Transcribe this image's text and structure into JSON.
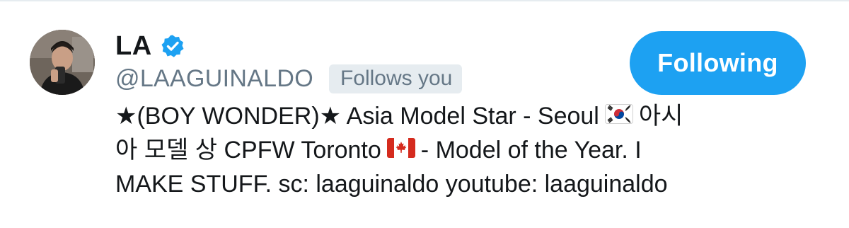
{
  "profile": {
    "display_name": "LA",
    "verified": true,
    "handle": "@LAAGUINALDO",
    "follows_you_label": "Follows you",
    "follow_button_label": "Following",
    "bio": {
      "line1_a": "★(BOY WONDER)★ Asia Model Star - Seoul",
      "line1_flag": "south-korea-flag-icon",
      "line1_b": "아시",
      "line2_a": "아 모델 상 CPFW Toronto",
      "line2_flag": "canada-flag-icon",
      "line2_b": "- Model of the Year. I",
      "line3": "MAKE STUFF. sc: laaguinaldo youtube: laaguinaldo"
    }
  },
  "colors": {
    "accent": "#1da1f2",
    "text_primary": "#14171a",
    "text_secondary": "#657786",
    "badge_bg": "#e6ecf0"
  }
}
